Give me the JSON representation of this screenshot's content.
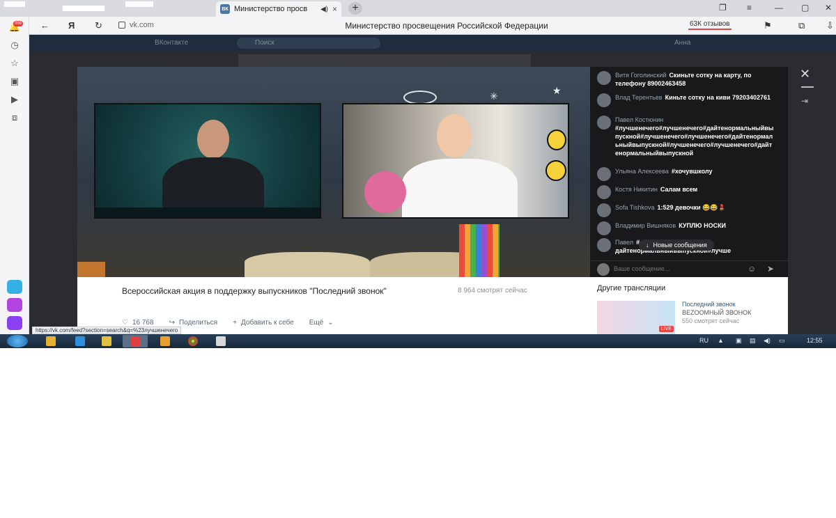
{
  "browser": {
    "tab_title": "Министерство просв",
    "tab_favicon": "ВК",
    "tab_audio_icon": "speaker-icon",
    "new_tab_icon": "+",
    "url": "vk.com",
    "page_title": "Министерство просвещения Российской Федерации",
    "reviews_label": "63К отзывов",
    "yandex_icon": "Я"
  },
  "sidebar": {
    "badge": "999",
    "app_colors": [
      "#35b0e6",
      "#b244e0",
      "#8a3ff0"
    ]
  },
  "vk_background": {
    "logo": "ВКонтакте",
    "search_placeholder": "Поиск",
    "user": "Анна"
  },
  "video": {
    "title": "Всероссийская акция в поддержку выпускников \"Последний звонок\"",
    "viewers": "8 964 смотрят сейчас",
    "likes": "16 768",
    "share_label": "Поделиться",
    "add_label": "Добавить к себе",
    "more_label": "Ещё"
  },
  "chat": {
    "messages": [
      {
        "name": "Витя Гоголинский",
        "text": "Скиньте сотку на карту, по телефону 89002463458"
      },
      {
        "name": "Влад Терентьев",
        "text": "Киньте сотку на киви 79203402761"
      },
      {
        "name": "Павел Костюнин",
        "text": "#лучшенечего#лучшенечего#дайтенормальныйвыпускной#лучшенечего#лучшенечего#дайтенормальныйвыпускной#лучшенечего#лучшенечего#дайтенормальныйвыпускной"
      },
      {
        "name": "Ульяна Алексеева",
        "text": "#хочувшколу"
      },
      {
        "name": "Костя Никитин",
        "text": "Салам всем"
      },
      {
        "name": "Sofa Tishkova",
        "text": "1:529 девочки 😂😂💄"
      },
      {
        "name": "Владимир Вишняков",
        "text": "КУПЛЮ НОСКИ"
      },
      {
        "name": "Павел",
        "text": "#лучше... дайтенормальныйвыпускной#лучше"
      }
    ],
    "new_messages_label": "Новые сообщения",
    "input_placeholder": "Ваше сообщение..."
  },
  "other_streams": {
    "heading": "Другие трансляции",
    "items": [
      {
        "title": "Последний звонок",
        "subtitle": "BEZOOMНЫЙ ЗВОНОК",
        "viewers": "550 смотрят сейчас",
        "badge": "LIVE"
      }
    ]
  },
  "status_url": "https://vk.com/feed?section=search&q=%23лучшенечего",
  "taskbar": {
    "lang": "RU",
    "time": "12:55"
  }
}
